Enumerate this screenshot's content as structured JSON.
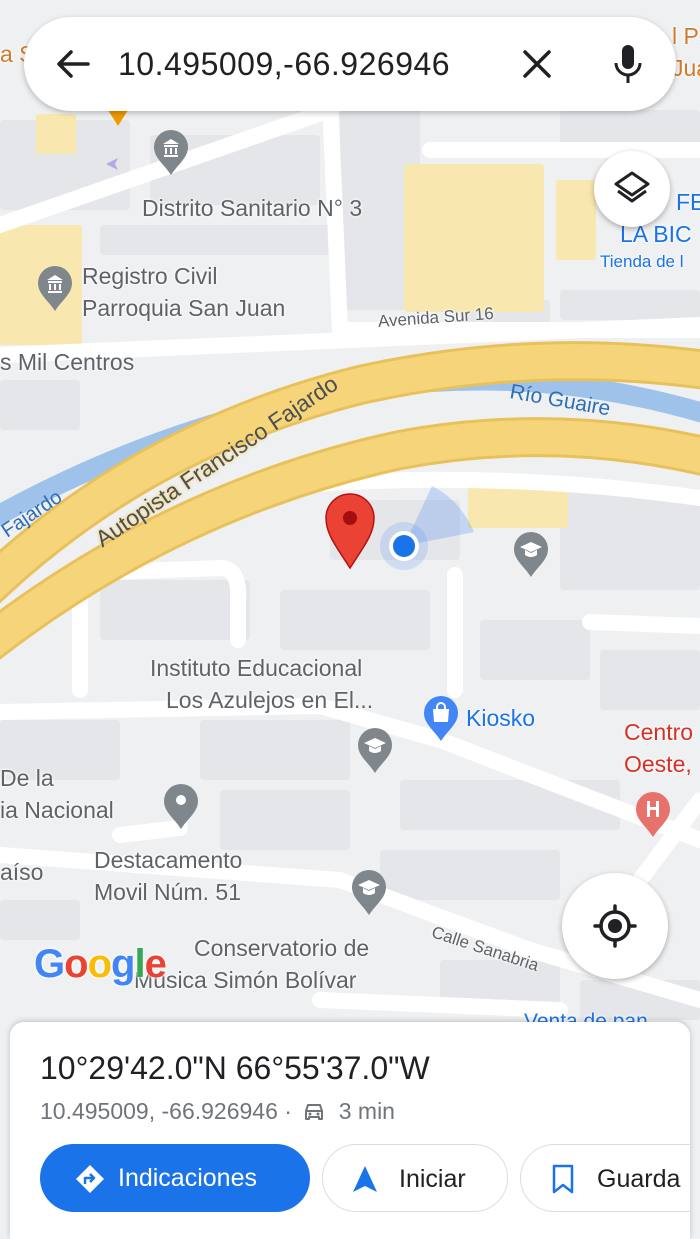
{
  "search": {
    "query": "10.495009,-66.926946"
  },
  "map_labels": {
    "distrito_sanitario": "Distrito Sanitario N° 3",
    "registro_civil_1": "Registro Civil",
    "registro_civil_2": "Parroquia San Juan",
    "mil_centros": "s Mil Centros",
    "avenida_sur": "Avenida Sur 16",
    "autopista": "Autopista Francisco Fajardo",
    "autopista_fragment": "Fajardo",
    "rio": "Río Guaire",
    "instituto_1": "Instituto Educacional",
    "instituto_2": "Los Azulejos en El...",
    "kiosko": "Kiosko",
    "centro_1": "Centro",
    "centro_2": "Oeste,",
    "de_la_1": "De la",
    "de_la_2": "ia Nacional",
    "destacamento_1": "Destacamento",
    "destacamento_2": "Movil Núm. 51",
    "aiso": "aíso",
    "calle_sanabria": "Calle Sanabria",
    "conservatorio_1": "Conservatorio de",
    "conservatorio_2": "Música Simón Bolívar",
    "venta_de_pan": "Venta de pan",
    "top_left_fragment": "a S",
    "top_right_1": "l Pa",
    "top_right_2": "Jua",
    "fe_1": "FE",
    "fe_2": "LA BIC",
    "fe_3": "Tienda de l"
  },
  "google_logo": "Google",
  "place": {
    "coordinates_dms": "10°29'42.0\"N 66°55'37.0\"W",
    "coordinates_decimal": "10.495009, -66.926946",
    "separator": "·",
    "drive_time": "3 min"
  },
  "actions": {
    "directions": "Indicaciones",
    "start": "Iniciar",
    "save": "Guarda"
  },
  "colors": {
    "accent": "#1a73e8",
    "pin_red": "#ea4335",
    "highway": "#f6d57a",
    "river": "#9ec2ea",
    "building": "#f8e7ae"
  },
  "icons": {
    "back": "arrow-left-icon",
    "clear": "close-icon",
    "mic": "microphone-icon",
    "layers": "layers-icon",
    "locate": "my-location-icon",
    "directions": "directions-diamond-icon",
    "start": "navigation-arrow-icon",
    "save": "bookmark-icon",
    "car": "car-icon"
  }
}
